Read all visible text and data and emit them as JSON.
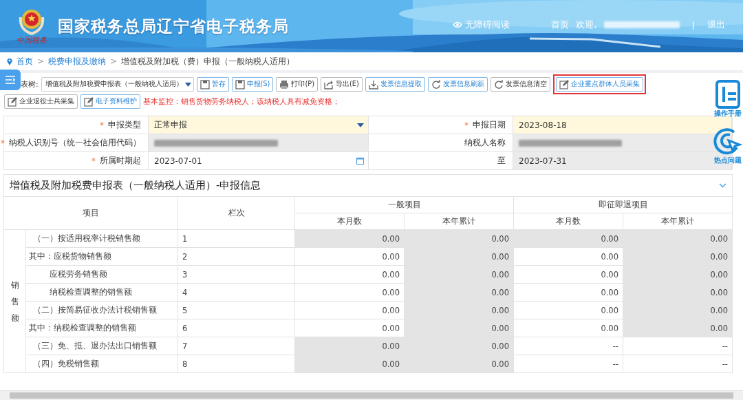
{
  "header": {
    "title": "国家税务总局辽宁省电子税务局",
    "logo_caption": "中国税务",
    "accessibility": "无障碍阅读",
    "home": "首页",
    "welcome": "欢迎,",
    "separator": "|",
    "logout": "退出"
  },
  "breadcrumb": [
    {
      "label": "首页"
    },
    {
      "separator": ">",
      "label": "税费申报及缴纳"
    },
    {
      "separator": ">",
      "label": "增值税及附加税（费）申报（一般纳税人适用）"
    }
  ],
  "toolbar": {
    "tree_label": "表树:",
    "tree_value": "增值税及附加税费申报表（一般纳税人适用）",
    "buttons": [
      {
        "label": "暂存",
        "highlighted": false
      },
      {
        "label": "申报(S)",
        "highlighted": false
      },
      {
        "label": "打印(P)",
        "highlighted": false
      },
      {
        "label": "导出(E)",
        "highlighted": false
      },
      {
        "label": "发票信息提取",
        "highlighted": false
      },
      {
        "label": "发票信息刷新",
        "highlighted": false
      },
      {
        "label": "发票信息清空",
        "highlighted": false
      },
      {
        "label": "企业重点群体人员采集",
        "highlighted": true
      },
      {
        "label": "企业退役士兵采集",
        "highlighted": false
      },
      {
        "label": "电子资料维护",
        "highlighted": false
      }
    ],
    "monitor": "基本监控：销售货物劳务纳税人；该纳税人具有减免资格；"
  },
  "float_tools": [
    {
      "label": "操作手册"
    },
    {
      "label": "热点问题"
    }
  ],
  "form": [
    [
      {
        "label": "申报类型",
        "required_mark": "*",
        "value": "正常申报",
        "kind": "select"
      },
      {
        "label": "申报日期",
        "required_mark": "*",
        "value": "2023-08-18",
        "kind": "input"
      }
    ],
    [
      {
        "label": "纳税人识别号（统一社会信用代码）",
        "required_mark": "*",
        "redacted": true,
        "kind": "readonly"
      },
      {
        "label": "纳税人名称",
        "redacted": true,
        "kind": "readonly"
      }
    ],
    [
      {
        "label": "所属时期起",
        "required_mark": "*",
        "value": "2023-07-01",
        "kind": "date"
      },
      {
        "label": "至",
        "value": "2023-07-31",
        "kind": "readonly"
      }
    ]
  ],
  "section": {
    "title": "增值税及附加税费申报表（一般纳税人适用）-申报信息",
    "expanded": true
  },
  "table": {
    "col_item": "项目",
    "col_line": "栏次",
    "groups": [
      "一般项目",
      "即征即退项目"
    ],
    "sub_columns": [
      "本月数",
      "本年累计",
      "本月数",
      "本年累计"
    ],
    "row_group": "销售额",
    "rows": [
      {
        "item": "（一）按适用税率计税销售额",
        "kind": "section",
        "line": "1",
        "cells": [
          {
            "value": "0.00",
            "shaded": true
          },
          {
            "value": "0.00",
            "shaded": true
          },
          {
            "value": "0.00",
            "shaded": true
          },
          {
            "value": "0.00",
            "shaded": true
          }
        ]
      },
      {
        "item": "其中：应税货物销售额",
        "kind": "detail",
        "line": "2",
        "cells": [
          {
            "value": "0.00",
            "shaded": false
          },
          {
            "value": "0.00",
            "shaded": true
          },
          {
            "value": "0.00",
            "shaded": false
          },
          {
            "value": "0.00",
            "shaded": true
          }
        ]
      },
      {
        "item": "应税劳务销售额",
        "kind": "continued",
        "line": "3",
        "cells": [
          {
            "value": "0.00",
            "shaded": false
          },
          {
            "value": "0.00",
            "shaded": true
          },
          {
            "value": "0.00",
            "shaded": false
          },
          {
            "value": "0.00",
            "shaded": true
          }
        ]
      },
      {
        "item": "纳税检查调整的销售额",
        "kind": "continued",
        "line": "4",
        "cells": [
          {
            "value": "0.00",
            "shaded": false
          },
          {
            "value": "0.00",
            "shaded": true
          },
          {
            "value": "0.00",
            "shaded": false
          },
          {
            "value": "0.00",
            "shaded": true
          }
        ]
      },
      {
        "item": "（二）按简易征收办法计税销售额",
        "kind": "section",
        "line": "5",
        "cells": [
          {
            "value": "0.00",
            "shaded": false
          },
          {
            "value": "0.00",
            "shaded": true
          },
          {
            "value": "0.00",
            "shaded": false
          },
          {
            "value": "0.00",
            "shaded": true
          }
        ]
      },
      {
        "item": "其中：纳税检查调整的销售额",
        "kind": "detail",
        "line": "6",
        "cells": [
          {
            "value": "0.00",
            "shaded": false
          },
          {
            "value": "0.00",
            "shaded": true
          },
          {
            "value": "0.00",
            "shaded": false
          },
          {
            "value": "0.00",
            "shaded": true
          }
        ]
      },
      {
        "item": "（三）免、抵、退办法出口销售额",
        "kind": "section",
        "line": "7",
        "cells": [
          {
            "value": "0.00",
            "shaded": true
          },
          {
            "value": "0.00",
            "shaded": true
          },
          {
            "value": "--",
            "shaded": false
          },
          {
            "value": "--",
            "shaded": false
          }
        ]
      },
      {
        "item": "（四）免税销售额",
        "kind": "section",
        "line": "8",
        "cells": [
          {
            "value": "0.00",
            "shaded": true
          },
          {
            "value": "0.00",
            "shaded": true
          },
          {
            "value": "--",
            "shaded": false
          },
          {
            "value": "--",
            "shaded": false
          }
        ]
      }
    ]
  }
}
